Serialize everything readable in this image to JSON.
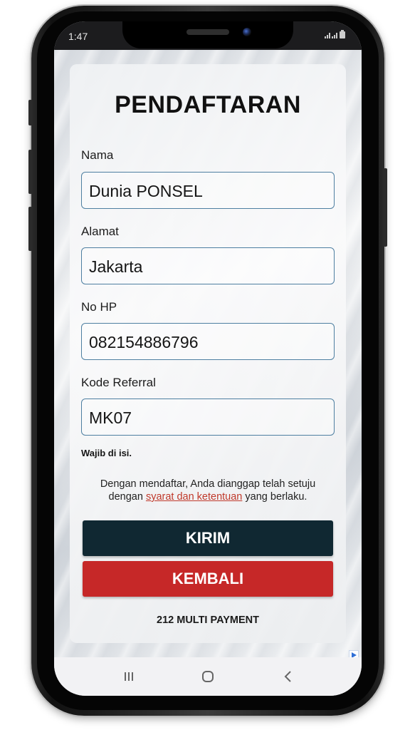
{
  "status_bar": {
    "time": "1:47",
    "icons": "signal-icon wifi-icon battery-icon"
  },
  "form": {
    "title": "PENDAFTARAN",
    "fields": [
      {
        "label": "Nama",
        "value": "Dunia PONSEL"
      },
      {
        "label": "Alamat",
        "value": "Jakarta"
      },
      {
        "label": "No HP",
        "value": "082154886796"
      },
      {
        "label": "Kode Referral",
        "value": "MK07"
      }
    ],
    "required_note": "Wajib di isi.",
    "terms": {
      "line1": "Dengan mendaftar, Anda dianggap telah setuju",
      "prefix": "dengan",
      "link": "syarat dan ketentuan",
      "suffix": "yang berlaku."
    },
    "submit_label": "KIRIM",
    "back_label": "KEMBALI",
    "footer": "212 MULTI PAYMENT"
  },
  "nav": {
    "icons": [
      "recent-apps-icon",
      "home-icon",
      "back-icon"
    ]
  },
  "colors": {
    "submit_bg": "#102832",
    "back_bg": "#c62828",
    "link": "#c0392b",
    "input_border": "#4e7fa1"
  }
}
